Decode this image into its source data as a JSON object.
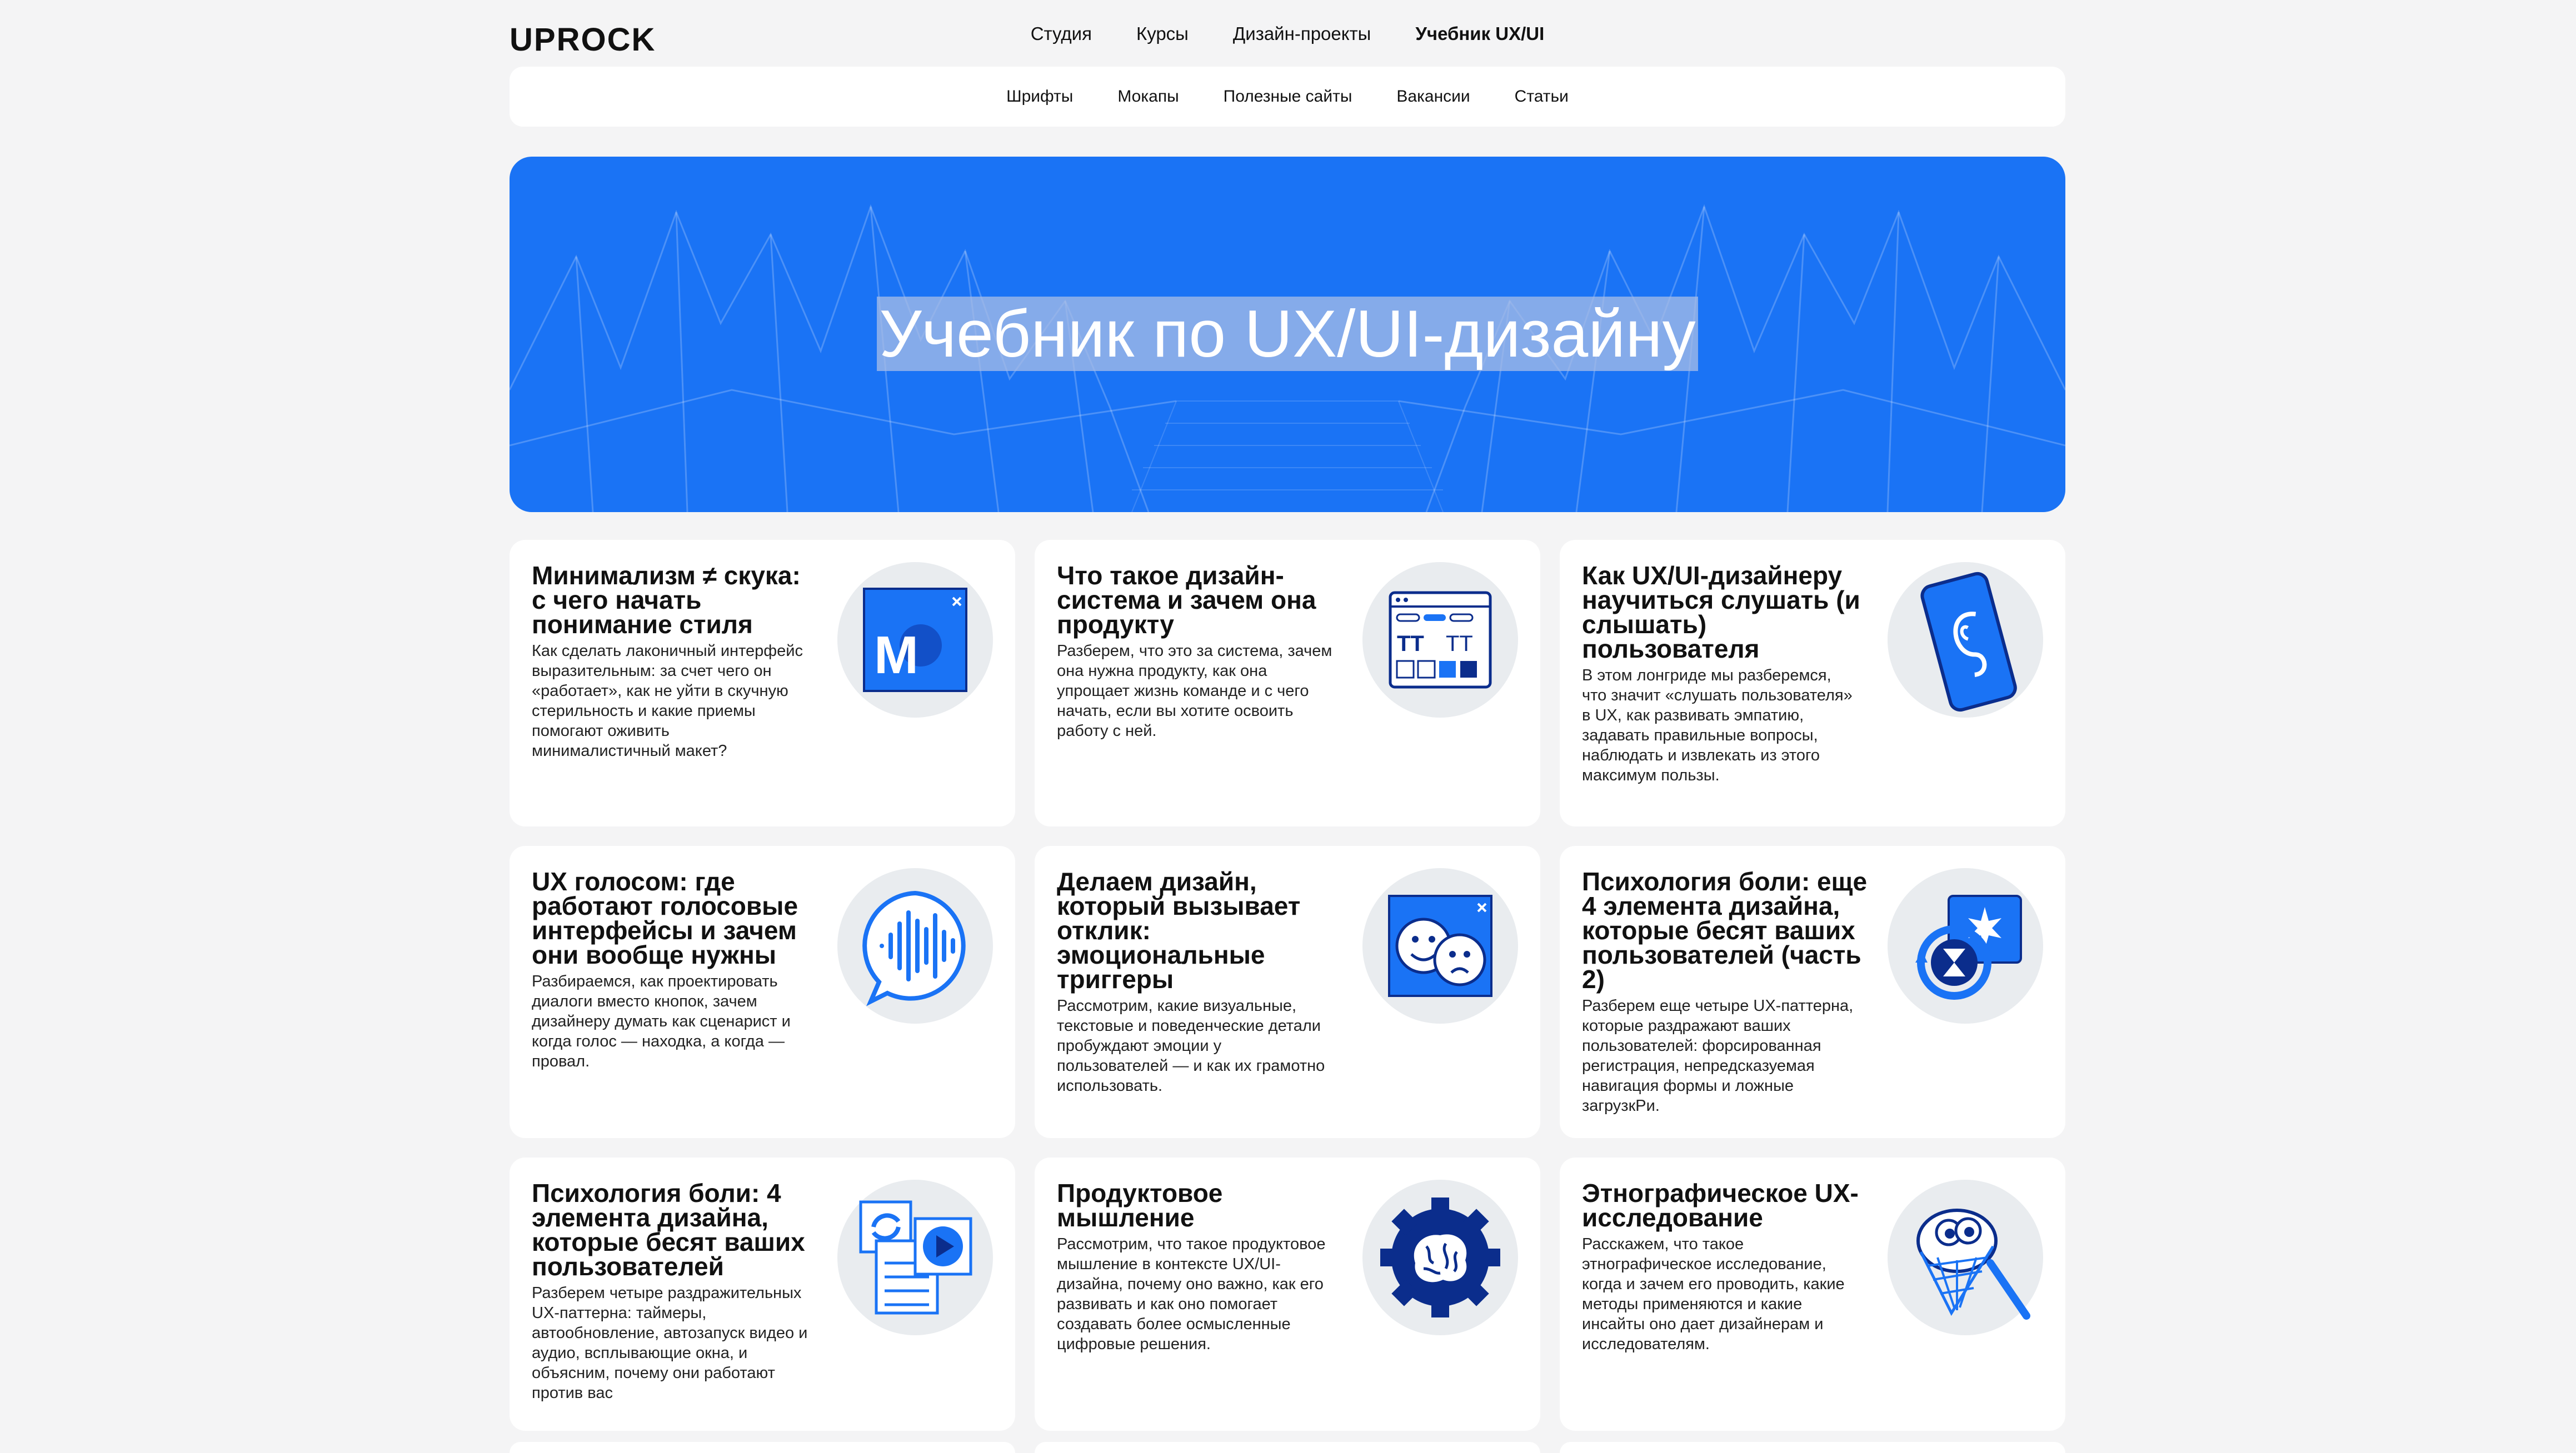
{
  "brand": {
    "logo": "UPROCK"
  },
  "main_nav": [
    {
      "label": "Студия",
      "active": false
    },
    {
      "label": "Курсы",
      "active": false
    },
    {
      "label": "Дизайн-проекты",
      "active": false
    },
    {
      "label": "Учебник UX/UI",
      "active": true
    }
  ],
  "sub_nav": [
    "Шрифты",
    "Мокапы",
    "Полезные сайты",
    "Вакансии",
    "Статьи"
  ],
  "hero": {
    "title": "Учебник по UX/UI-дизайну",
    "color": "#1a73f5"
  },
  "articles": [
    {
      "title": "Минимализм ≠ скука: с чего начать понимание стиля",
      "desc": "Как сделать лаконичный интерфейс выразительным: за счет чего он «работает», как не уйти в скучную стерильность и какие приемы помогают оживить минималистичный макет?",
      "icon": "minimalism-m-icon"
    },
    {
      "title": "Что такое дизайн-система и зачем она продукту",
      "desc": "Разберем, что это за система, зачем она нужна продукту, как она упрощает жизнь команде и с чего начать, если вы хотите освоить работу с ней.",
      "icon": "design-system-icon"
    },
    {
      "title": "Как UX/UI-дизайнеру научиться слушать (и слышать) пользователя",
      "desc": "В этом лонгриде мы разберемся, что значит «слушать пользователя» в UX, как развивать эмпатию, задавать правильные вопросы, наблюдать и извлекать из этого максимум пользы.",
      "icon": "phone-ear-icon"
    },
    {
      "title": "UX голосом: где работают голосовые интерфейсы и зачем они вообще нужны",
      "desc": "Разбираемся, как проектировать диалоги вместо кнопок, зачем дизайнеру думать как сценарист и когда голос — находка, а когда — провал.",
      "icon": "voice-wave-icon"
    },
    {
      "title": "Делаем дизайн, который вызывает отклик: эмоциональные триггеры",
      "desc": "Рассмотрим, какие визуальные, текстовые и поведенческие детали пробуждают эмоции у пользователей — и как их грамотно использовать.",
      "icon": "emotion-faces-icon"
    },
    {
      "title": "Психология боли: еще 4 элемента дизайна, которые бесят ваших пользователей (часть 2)",
      "desc": "Разберем еще четыре UX-паттерна, которые раздражают ваших пользователей: форсированная регистрация, непредсказуемая навигация формы и ложные загрузкРи.",
      "icon": "hourglass-cycle-icon"
    },
    {
      "title": "Психология боли: 4 элемента дизайна, которые бесят ваших пользователей",
      "desc": "Разберем четыре раздражительных UX-паттерна: таймеры, автообновление, автозапуск видео и аудио, всплывающие окна, и объясним, почему они работают против вас",
      "icon": "refresh-play-icon"
    },
    {
      "title": "Продуктовое мышление",
      "desc": "Рассмотрим, что такое продуктовое мышление в контексте UX/UI-дизайна, почему оно важно, как его развивать и как оно помогает создавать более осмысленные цифровые решения.",
      "icon": "brain-gear-icon"
    },
    {
      "title": "Этнографическое UX-исследование",
      "desc": "Расскажем, что такое этнографическое исследование, когда и зачем его проводить, какие методы применяются и какие инсайты оно дает дизайнерам и исследователям.",
      "icon": "net-catch-icon"
    }
  ]
}
